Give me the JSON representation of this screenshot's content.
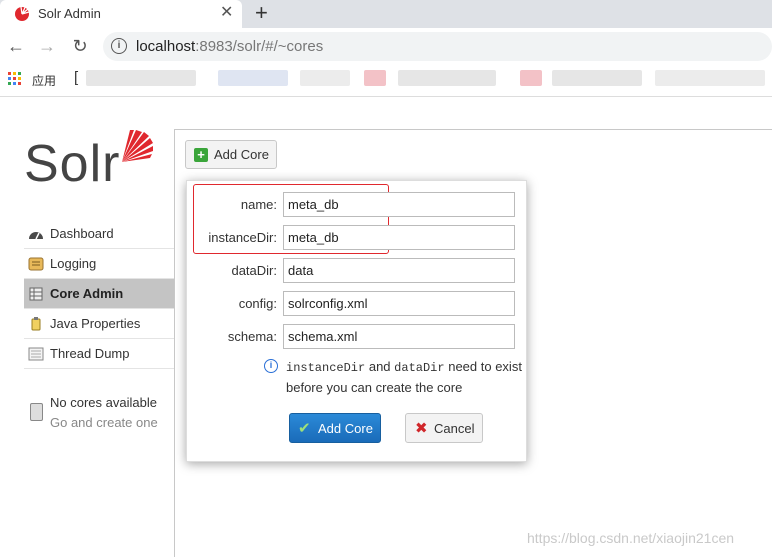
{
  "browser": {
    "tab_title": "Solr Admin",
    "tab_close": "✕",
    "new_tab": "+",
    "url_host": "localhost",
    "url_rest": ":8983/solr/#/~cores",
    "apps_label": "应用",
    "bookmark_bracket": "["
  },
  "logo": {
    "text": "Solr"
  },
  "sidebar": {
    "items": [
      {
        "label": "Dashboard",
        "icon": "dashboard-icon"
      },
      {
        "label": "Logging",
        "icon": "logging-icon"
      },
      {
        "label": "Core Admin",
        "icon": "core-admin-icon",
        "active": true
      },
      {
        "label": "Java Properties",
        "icon": "java-properties-icon"
      },
      {
        "label": "Thread Dump",
        "icon": "thread-dump-icon"
      }
    ],
    "no_cores": {
      "title": "No cores available",
      "subtitle": "Go and create one"
    }
  },
  "toolbar": {
    "add_core_label": "Add Core"
  },
  "dialog": {
    "fields": [
      {
        "label": "name:",
        "value": "meta_db"
      },
      {
        "label": "instanceDir:",
        "value": "meta_db"
      },
      {
        "label": "dataDir:",
        "value": "data"
      },
      {
        "label": "config:",
        "value": "solrconfig.xml"
      },
      {
        "label": "schema:",
        "value": "schema.xml"
      }
    ],
    "hint_code1": "instanceDir",
    "hint_and": "and",
    "hint_code2": "dataDir",
    "hint_rest": "need to exist before you can create the core",
    "submit_label": "Add Core",
    "cancel_label": "Cancel"
  },
  "colors": {
    "accent": "#1a6bb9",
    "solr_red": "#e0282e",
    "highlight_box": "#e0282e"
  },
  "watermark": "https://blog.csdn.net/xiaojin21cen"
}
